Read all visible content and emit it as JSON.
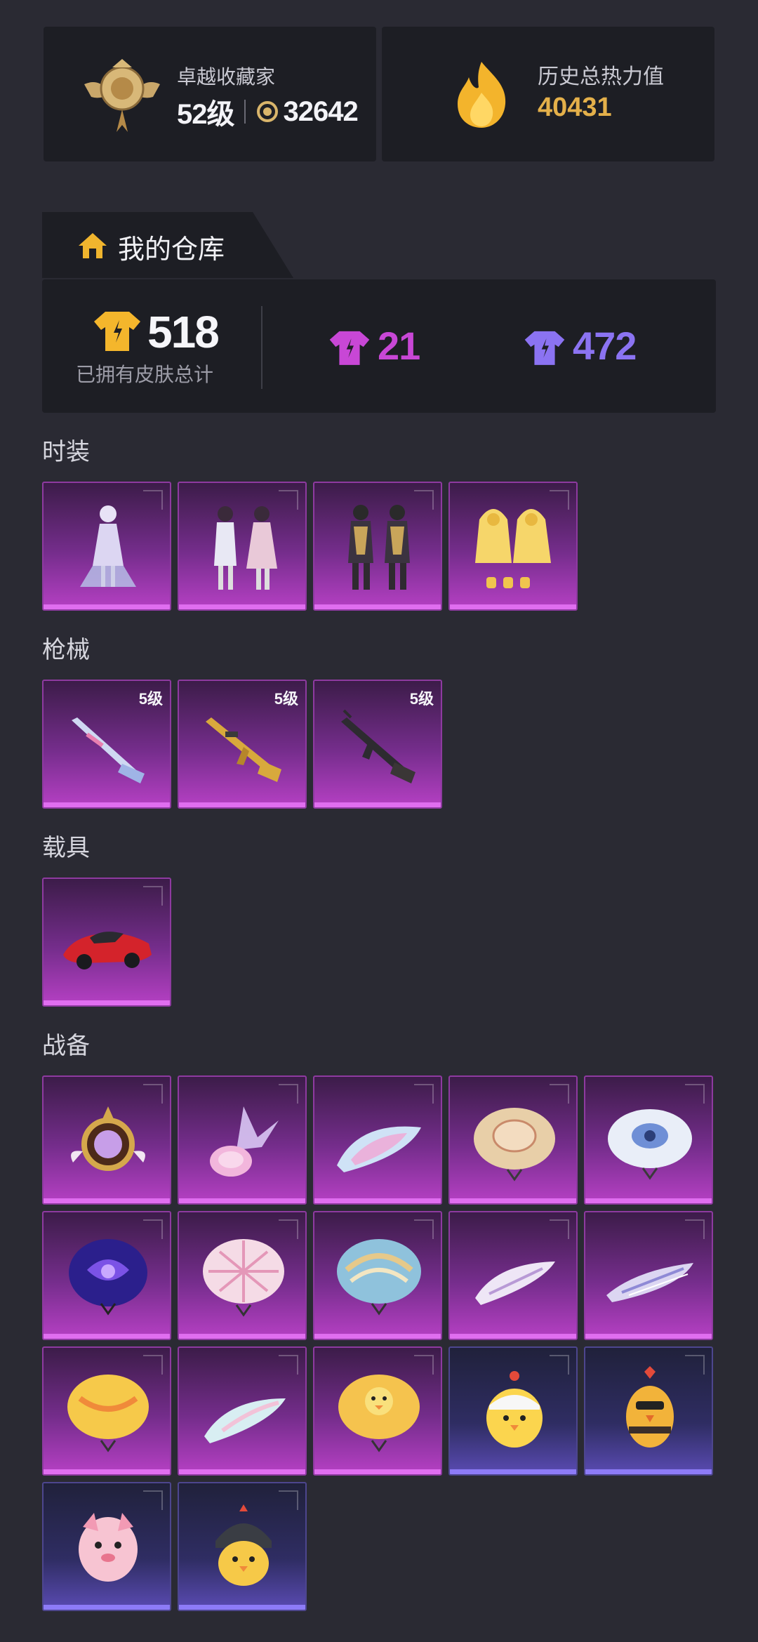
{
  "collector": {
    "title": "卓越收藏家",
    "level": "52级",
    "points": "32642"
  },
  "heat": {
    "title": "历史总热力值",
    "value": "40431"
  },
  "warehouse": {
    "title": "我的仓库"
  },
  "summary": {
    "total": "518",
    "total_label": "已拥有皮肤总计",
    "purple_count": "21",
    "blue_count": "472"
  },
  "sections": {
    "fashion": {
      "title": "时装"
    },
    "guns": {
      "title": "枪械",
      "levels": [
        "5级",
        "5级",
        "5级"
      ]
    },
    "vehicles": {
      "title": "载具"
    },
    "gear": {
      "title": "战备"
    }
  },
  "colors": {
    "purple_accent": "#c847d6",
    "blue_accent": "#8b73f2",
    "gold": "#e4b04a"
  }
}
